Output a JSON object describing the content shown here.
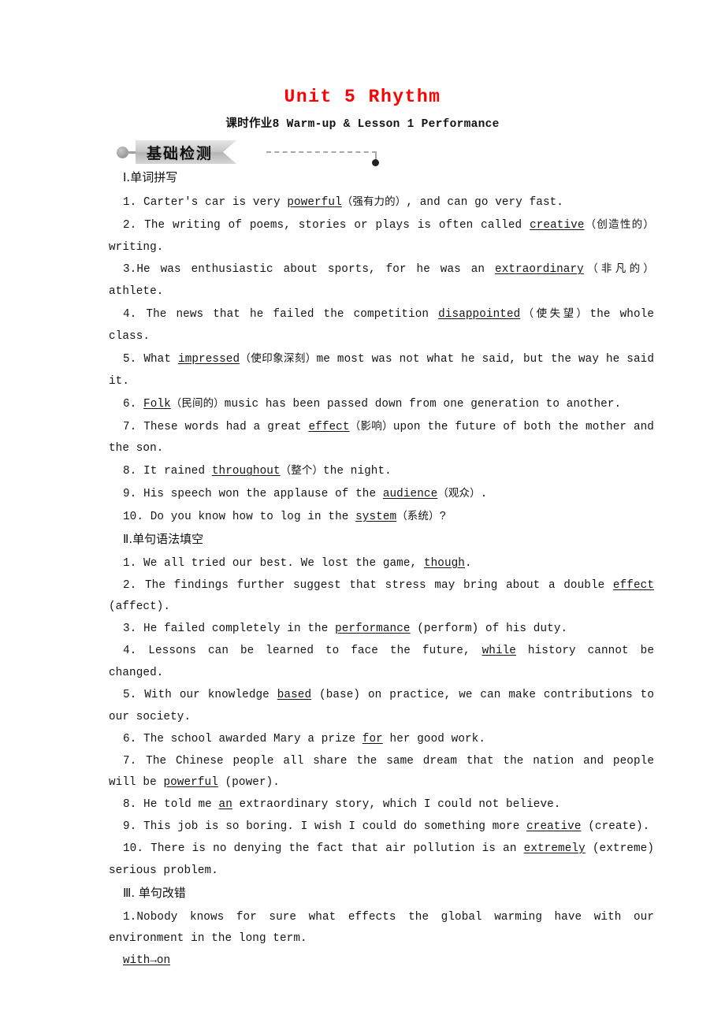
{
  "document": {
    "unit_title": "Unit 5  Rhythm",
    "subtitle": "课时作业8  Warm-up & Lesson 1  Performance",
    "badge_label": "基础检测"
  },
  "sections": [
    {
      "heading": "Ⅰ.单词拼写",
      "items": [
        "1. Carter's car is very powerful（强有力的）, and can go very fast.",
        "2. The writing of poems, stories or plays is often called creative（创造性的）writing.",
        "3.He was enthusiastic about sports, for he was an extraordinary（非凡的）athlete.",
        "4. The news that he failed the competition disappointed（使失望）the whole class.",
        "5. What impressed（使印象深刻）me most was not what he said, but the way he said it.",
        "6. Folk（民间的）music has been passed down from one generation to another.",
        "7. These words had a great effect（影响）upon the future of both the mother and the son.",
        "8. It rained throughout（整个）the night.",
        "9. His speech won the applause of the audience（观众）.",
        "10. Do you know how to log in the system（系统）?"
      ]
    },
    {
      "heading": "Ⅱ.单句语法填空",
      "items": [
        "1. We all tried our best. We lost the game, though.",
        "2. The findings further suggest that stress may bring about a double effect (affect).",
        "3. He failed completely in the performance (perform) of his duty.",
        "4. Lessons can be learned to face the future, while history cannot be changed.",
        "5. With our knowledge based (base) on practice, we can make contributions to our society.",
        "6. The school awarded Mary a prize for her good work.",
        "7. The Chinese people all share the same dream that the nation and people will be powerful (power).",
        "8. He told me an extraordinary story, which I could not believe.",
        "9. This job is so boring. I wish I could do something more creative (create).",
        "10. There is no denying the fact that air pollution is an extremely (extreme) serious problem."
      ]
    },
    {
      "heading": "Ⅲ. 单句改错",
      "items": [
        "1.Nobody knows for sure what effects the global warming have with our environment in the long term."
      ],
      "answer": "with→on"
    }
  ],
  "colors": {
    "title_red": "#fe0000",
    "text": "#141414",
    "badge_gray": "#c6c6c6"
  }
}
